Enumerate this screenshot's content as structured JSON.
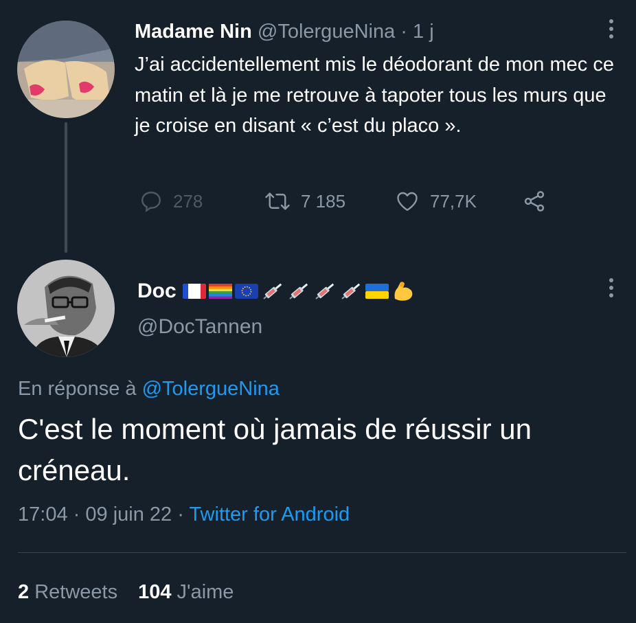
{
  "parent_tweet": {
    "author_name": "Madame Nin",
    "author_handle": "@TolergueNina",
    "separator": "·",
    "time": "1 j",
    "text": "J’ai accidentellement mis le déodorant de mon mec ce matin et là je me retrouve à tapoter tous les murs que je croise en disant « c’est du placo ».",
    "actions": {
      "reply_icon": "reply-bubble-icon",
      "replies": "278",
      "retweet_icon": "retweet-icon",
      "retweets": "7 185",
      "like_icon": "heart-icon",
      "likes": "77,7K",
      "share_icon": "share-icon"
    }
  },
  "reply_tweet": {
    "author_name": "Doc",
    "author_emojis": [
      "flag-france",
      "flag-rainbow",
      "flag-eu",
      "syringe",
      "syringe",
      "syringe",
      "syringe",
      "flag-ukraine",
      "flexed-biceps"
    ],
    "author_handle": "@DocTannen",
    "in_reply_prefix": "En réponse à",
    "in_reply_handle": "@TolergueNina",
    "text": "C'est le moment où jamais de réussir un créneau.",
    "time": "17:04",
    "date": "09 juin 22",
    "separator": "·",
    "client": "Twitter for Android",
    "retweet_count": "2",
    "retweet_label": "Retweets",
    "like_count": "104",
    "like_label": "J'aime"
  },
  "colors": {
    "background": "#15202b",
    "text": "#ffffff",
    "muted": "#8b98a5",
    "link": "#1d9bf0",
    "divider": "#38444d"
  }
}
